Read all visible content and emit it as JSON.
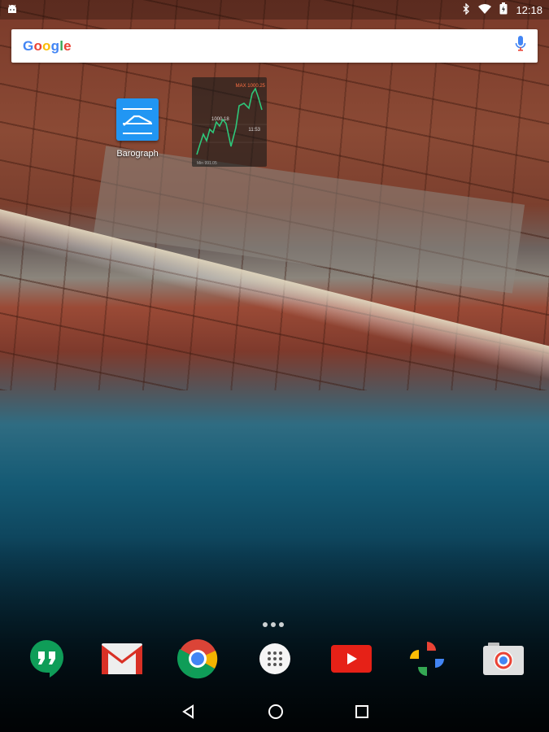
{
  "status_bar": {
    "time": "12:18",
    "icons": [
      "android-icon",
      "bluetooth-icon",
      "wifi-icon",
      "battery-icon"
    ]
  },
  "search": {
    "logo_text": "Google",
    "mic_icon": "mic-icon"
  },
  "home": {
    "apps": [
      {
        "label": "Barograph",
        "icon": "barograph-icon"
      }
    ],
    "widget": {
      "max_label": "MAX 1000.25",
      "current_value": "1000.18",
      "time_label": "11:53",
      "footer_label": "Min 991.05",
      "line_color": "#2ec77a"
    },
    "page_dots": 3
  },
  "dock": {
    "apps": [
      {
        "name": "Hangouts",
        "icon": "hangouts-icon"
      },
      {
        "name": "Gmail",
        "icon": "gmail-icon"
      },
      {
        "name": "Chrome",
        "icon": "chrome-icon"
      },
      {
        "name": "Apps",
        "icon": "app-drawer-icon"
      },
      {
        "name": "YouTube",
        "icon": "youtube-icon"
      },
      {
        "name": "Photos",
        "icon": "photos-icon"
      },
      {
        "name": "Camera",
        "icon": "camera-icon"
      }
    ]
  },
  "nav": {
    "buttons": [
      "back-icon",
      "home-icon",
      "recents-icon"
    ]
  },
  "colors": {
    "google_blue": "#4285f4",
    "google_red": "#ea4335",
    "google_yellow": "#fbbc05",
    "google_green": "#34a853",
    "barograph_blue": "#2196f3"
  }
}
